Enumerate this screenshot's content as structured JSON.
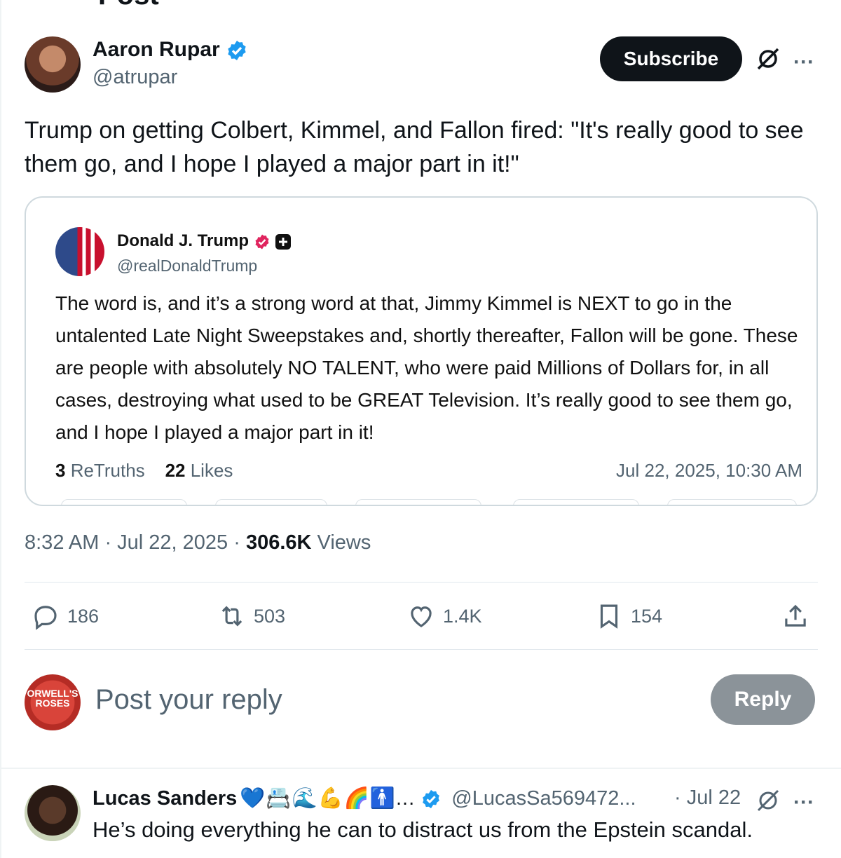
{
  "header": {
    "title": "Post"
  },
  "main_post": {
    "author_name": "Aaron Rupar",
    "author_handle": "@atrupar",
    "subscribe_label": "Subscribe",
    "text": "Trump on getting Colbert, Kimmel, and Fallon fired: \"It's really good to see them go, and I hope I played a major part in it!\"",
    "timestamp": "8:32 AM · Jul 22, 2025 · ",
    "views_count": "306.6K",
    "views_label": " Views"
  },
  "quote": {
    "author_name": "Donald J. Trump",
    "author_handle": "@realDonaldTrump",
    "text": "The word is, and it’s a strong word at that, Jimmy Kimmel is NEXT to go in the untalented Late Night Sweepstakes and, shortly thereafter, Fallon will be gone. These are people with absolutely NO TALENT, who were paid Millions of Dollars for, in all cases, destroying what used to be GREAT Television. It’s really good to see them go, and I hope I played a major part in it!",
    "retruths_count": "3",
    "retruths_label": " ReTruths",
    "likes_count": "22",
    "likes_label": " Likes",
    "date": "Jul 22, 2025, 10:30 AM"
  },
  "actions": {
    "replies": "186",
    "reposts": "503",
    "likes": "1.4K",
    "bookmarks": "154"
  },
  "reply_box": {
    "placeholder": "Post your reply",
    "button_label": "Reply",
    "avatar_text": "ORWELL'S ROSES"
  },
  "replies": [
    {
      "name": "Lucas Sanders",
      "emojis": "💙📇🌊💪🌈🚹...",
      "handle": "@LucasSa569472...",
      "date": "· Jul 22",
      "text": "He’s doing everything he can to distract us from the Epstein scandal."
    }
  ],
  "colors": {
    "accent_blue": "#1d9bf0",
    "text_primary": "#0f1419",
    "text_secondary": "#536471",
    "truth_badge": "#e0245e"
  },
  "icons": [
    "back-arrow-icon",
    "verified-badge-icon",
    "grok-icon",
    "more-icon",
    "reply-icon",
    "repost-icon",
    "like-icon",
    "bookmark-icon",
    "share-icon"
  ]
}
